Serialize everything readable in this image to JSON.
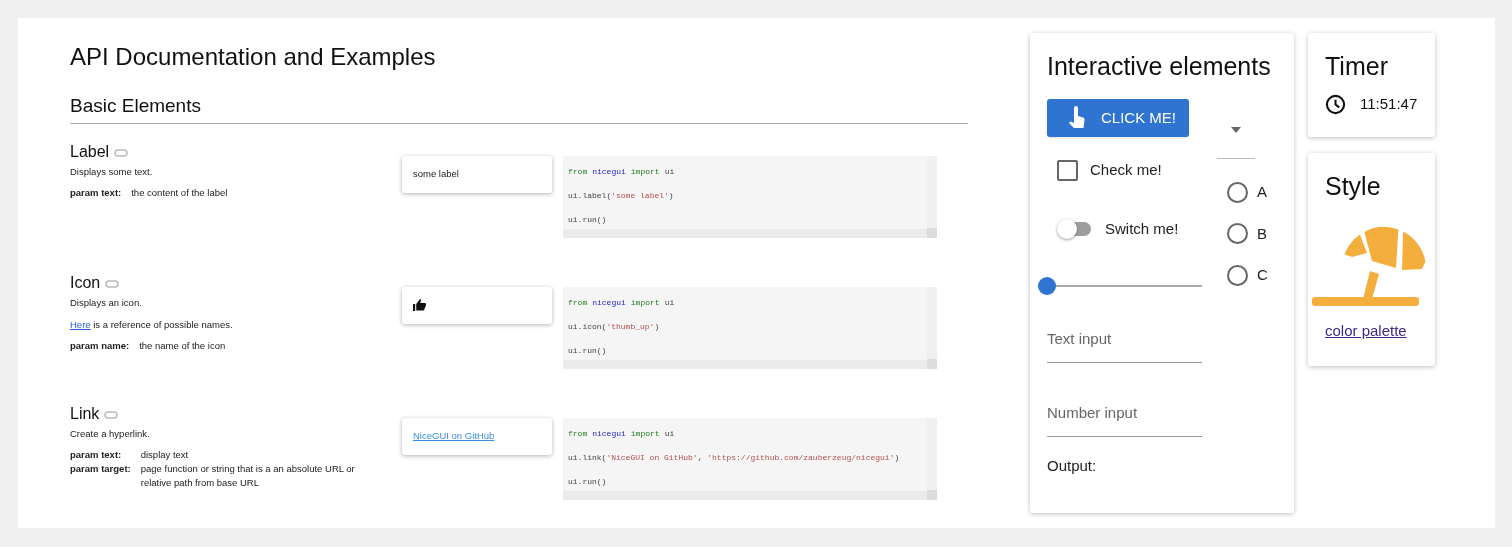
{
  "title": "API Documentation and Examples",
  "section": "Basic Elements",
  "docs": [
    {
      "title": "Label",
      "paragraphs": [
        [
          {
            "kind": "text",
            "text": "Displays some text."
          }
        ]
      ],
      "params": [
        {
          "name": "param text:",
          "text": "the content of the label"
        }
      ],
      "demo": {
        "kind": "label",
        "text": "some label"
      },
      "code": [
        [
          {
            "kind": "keyword",
            "text": "from"
          },
          {
            "kind": "module",
            "text": "nicegui"
          },
          {
            "kind": "keyword",
            "text": "import"
          },
          {
            "kind": "plain",
            "text": "ui"
          }
        ],
        [
          {
            "kind": "plain",
            "text": "ui.label("
          },
          {
            "kind": "string",
            "text": "'some label'"
          },
          {
            "kind": "plain",
            "text": ")"
          }
        ],
        [
          {
            "kind": "plain",
            "text": "ui.run()"
          }
        ]
      ]
    },
    {
      "title": "Icon",
      "paragraphs": [
        [
          {
            "kind": "text",
            "text": "Displays an icon."
          }
        ],
        [
          {
            "kind": "link",
            "text": "Here"
          },
          {
            "kind": "text",
            "text": " is a reference of possible names."
          }
        ]
      ],
      "params": [
        {
          "name": "param name:",
          "text": "the name of the icon"
        }
      ],
      "demo": {
        "kind": "icon"
      },
      "code": [
        [
          {
            "kind": "keyword",
            "text": "from"
          },
          {
            "kind": "module",
            "text": "nicegui"
          },
          {
            "kind": "keyword",
            "text": "import"
          },
          {
            "kind": "plain",
            "text": "ui"
          }
        ],
        [
          {
            "kind": "plain",
            "text": "ui.icon("
          },
          {
            "kind": "string",
            "text": "'thumb_up'"
          },
          {
            "kind": "plain",
            "text": ")"
          }
        ],
        [
          {
            "kind": "plain",
            "text": "ui.run()"
          }
        ]
      ]
    },
    {
      "title": "Link",
      "paragraphs": [
        [
          {
            "kind": "text",
            "text": "Create a hyperlink."
          }
        ]
      ],
      "params": [
        {
          "name": "param text:",
          "text": "display text"
        },
        {
          "name": "param target:",
          "text": "page function or string that is a an absolute URL or relative path from base URL"
        }
      ],
      "demo": {
        "kind": "link",
        "text": "NiceGUI on GitHub"
      },
      "code": [
        [
          {
            "kind": "keyword",
            "text": "from"
          },
          {
            "kind": "module",
            "text": "nicegui"
          },
          {
            "kind": "keyword",
            "text": "import"
          },
          {
            "kind": "plain",
            "text": "ui"
          }
        ],
        [
          {
            "kind": "plain",
            "text": "ui.link("
          },
          {
            "kind": "string",
            "text": "'NiceGUI on GitHub'"
          },
          {
            "kind": "plain",
            "text": ", "
          },
          {
            "kind": "string",
            "text": "'https://github.com/zauberzeug/nicegui'"
          },
          {
            "kind": "plain",
            "text": ")"
          }
        ],
        [
          {
            "kind": "plain",
            "text": "ui.run()"
          }
        ]
      ]
    }
  ],
  "interactive": {
    "title": "Interactive elements",
    "button": "CLICK ME!",
    "checkbox": {
      "label": "Check me!",
      "checked": false
    },
    "switch": {
      "label": "Switch me!",
      "on": false
    },
    "slider": {
      "level": 0
    },
    "radios": [
      {
        "label": "A",
        "selected": false
      },
      {
        "label": "B",
        "selected": false
      },
      {
        "label": "C",
        "selected": false
      }
    ],
    "inputs": [
      {
        "placeholder": "Text input"
      },
      {
        "placeholder": "Number input"
      }
    ],
    "output": "Output:"
  },
  "timer": {
    "title": "Timer",
    "time": "11:51:47"
  },
  "style": {
    "title": "Style",
    "link": "color palette"
  }
}
